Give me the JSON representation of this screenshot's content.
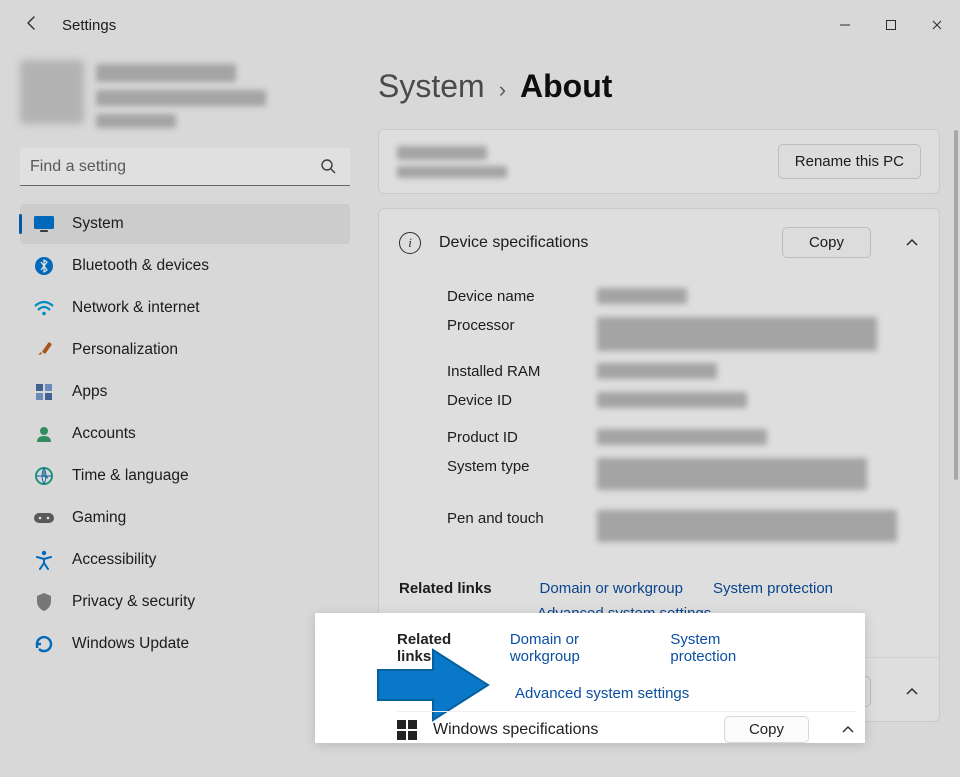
{
  "titlebar": {
    "title": "Settings"
  },
  "search": {
    "placeholder": "Find a setting"
  },
  "nav": {
    "items": [
      {
        "label": "System"
      },
      {
        "label": "Bluetooth & devices"
      },
      {
        "label": "Network & internet"
      },
      {
        "label": "Personalization"
      },
      {
        "label": "Apps"
      },
      {
        "label": "Accounts"
      },
      {
        "label": "Time & language"
      },
      {
        "label": "Gaming"
      },
      {
        "label": "Accessibility"
      },
      {
        "label": "Privacy & security"
      },
      {
        "label": "Windows Update"
      }
    ]
  },
  "breadcrumb": {
    "parent": "System",
    "sep": "›",
    "current": "About"
  },
  "rename_btn": "Rename this PC",
  "device_spec": {
    "title": "Device specifications",
    "copy": "Copy",
    "rows": {
      "device_name": "Device name",
      "processor": "Processor",
      "installed_ram": "Installed RAM",
      "device_id": "Device ID",
      "product_id": "Product ID",
      "system_type": "System type",
      "pen_touch": "Pen and touch"
    }
  },
  "related": {
    "title": "Related links",
    "domain": "Domain or workgroup",
    "protection": "System protection",
    "advanced": "Advanced system settings"
  },
  "win_spec": {
    "title": "Windows specifications",
    "copy": "Copy"
  }
}
